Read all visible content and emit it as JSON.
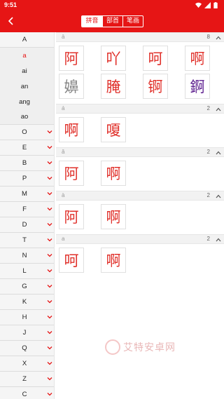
{
  "status_bar": {
    "time": "9:51"
  },
  "toolbar": {
    "tabs": [
      {
        "label": "拼音",
        "active": true
      },
      {
        "label": "部首",
        "active": false
      },
      {
        "label": "笔画",
        "active": false
      }
    ]
  },
  "sidebar": {
    "top_letter": "A",
    "sub_items": [
      "a",
      "ai",
      "an",
      "ang",
      "ao"
    ],
    "selected_sub": "a",
    "letters": [
      "O",
      "E",
      "B",
      "P",
      "M",
      "F",
      "D",
      "T",
      "N",
      "L",
      "G",
      "K",
      "H",
      "J",
      "Q",
      "X",
      "Z",
      "C"
    ]
  },
  "groups": [
    {
      "pinyin": "ā",
      "count": "8",
      "chars": [
        {
          "c": "阿",
          "color": "#e0302a"
        },
        {
          "c": "吖",
          "color": "#e0302a"
        },
        {
          "c": "呵",
          "color": "#e0302a"
        },
        {
          "c": "啊",
          "color": "#e0302a"
        },
        {
          "c": "嬶",
          "color": "#888888"
        },
        {
          "c": "腌",
          "color": "#e0302a"
        },
        {
          "c": "锕",
          "color": "#e0302a"
        },
        {
          "c": "錒",
          "color": "#5a1a8c"
        }
      ]
    },
    {
      "pinyin": "á",
      "count": "2",
      "chars": [
        {
          "c": "啊",
          "color": "#e0302a"
        },
        {
          "c": "嗄",
          "color": "#e0302a"
        }
      ]
    },
    {
      "pinyin": "ǎ",
      "count": "2",
      "chars": [
        {
          "c": "阿",
          "color": "#e0302a"
        },
        {
          "c": "啊",
          "color": "#e0302a"
        }
      ]
    },
    {
      "pinyin": "à",
      "count": "2",
      "chars": [
        {
          "c": "阿",
          "color": "#e0302a"
        },
        {
          "c": "啊",
          "color": "#e0302a"
        }
      ]
    },
    {
      "pinyin": "a",
      "count": "2",
      "chars": [
        {
          "c": "呵",
          "color": "#e0302a"
        },
        {
          "c": "啊",
          "color": "#e0302a"
        }
      ]
    }
  ],
  "watermark": {
    "text": "艾特安卓网"
  },
  "colors": {
    "brand_red": "#e61515",
    "char_red": "#e0302a"
  }
}
